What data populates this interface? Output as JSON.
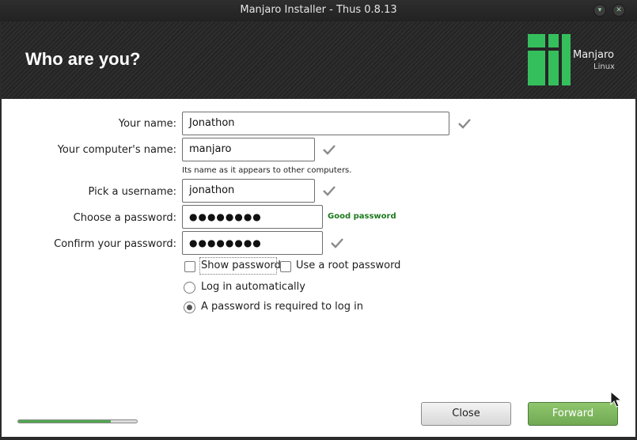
{
  "window": {
    "title": "Manjaro Installer - Thus 0.8.13"
  },
  "header": {
    "heading": "Who are you?",
    "logo_name": "Manjaro",
    "logo_sub": "Linux"
  },
  "form": {
    "name_label": "Your name:",
    "name_value": "Jonathon",
    "computer_label": "Your computer's name:",
    "computer_value": "manjaro",
    "computer_hint": "Its name as it appears to other computers.",
    "username_label": "Pick a username:",
    "username_value": "jonathon",
    "password_label": "Choose a password:",
    "password_value": "●●●●●●●●",
    "password_strength": "Good password",
    "confirm_label": "Confirm your password:",
    "confirm_value": "●●●●●●●●",
    "show_password": "Show password",
    "show_password_checked": false,
    "root_password": "Use a root password",
    "root_password_checked": false,
    "login_auto": "Log in automatically",
    "login_password": "A password is required to log in",
    "login_selected": "password"
  },
  "footer": {
    "progress_fraction": 0.78,
    "close_label": "Close",
    "forward_label": "Forward"
  },
  "colors": {
    "accent": "#35bf5c",
    "good": "#1c7a1c",
    "forward": "#7cb65d"
  }
}
